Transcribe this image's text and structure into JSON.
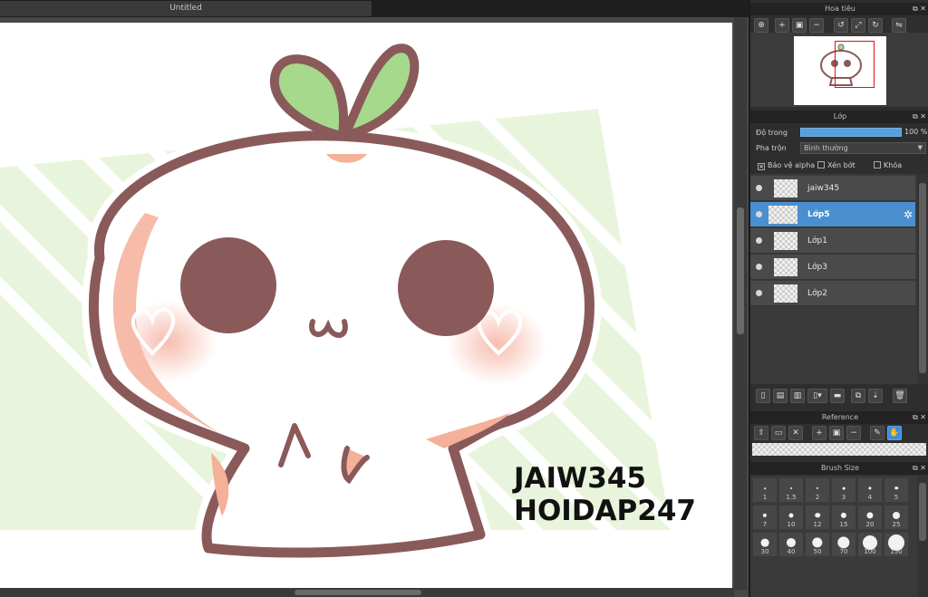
{
  "document": {
    "tab_title": "Untitled"
  },
  "canvas": {
    "watermark_line1": "JAIW345",
    "watermark_line2": "HOIDAP247"
  },
  "navigator": {
    "title": "Hoa tiêu",
    "tools": [
      "zoom-icon",
      "zoom-in-icon",
      "fit-icon",
      "zoom-out-icon",
      "rotate-left-icon",
      "fit-screen-icon",
      "rotate-right-icon",
      "flip-icon"
    ]
  },
  "layers_panel": {
    "title": "Lớp",
    "opacity_label": "Độ trong",
    "opacity_value": "100 %",
    "opacity_percent": 100,
    "blend_label": "Pha trộn",
    "blend_value": "Bình thường",
    "protect_alpha_label": "Bảo vệ alpha",
    "clipping_label": "Xén bớt",
    "lock_label": "Khóa",
    "layers": [
      {
        "name": "jaiw345",
        "selected": false
      },
      {
        "name": "Lớp5",
        "selected": true
      },
      {
        "name": "Lớp1",
        "selected": false
      },
      {
        "name": "Lớp3",
        "selected": false
      },
      {
        "name": "Lớp2",
        "selected": false
      }
    ]
  },
  "reference_panel": {
    "title": "Reference"
  },
  "brush_size_panel": {
    "title": "Brush Size",
    "sizes": [
      "1",
      "1.5",
      "2",
      "3",
      "4",
      "5",
      "7",
      "10",
      "12",
      "15",
      "20",
      "25",
      "30",
      "40",
      "50",
      "70",
      "100",
      "150"
    ]
  },
  "colors": {
    "accent": "#4a8fd0",
    "panel_bg": "#2e2e2e",
    "character_outline": "#8a5a5a"
  }
}
